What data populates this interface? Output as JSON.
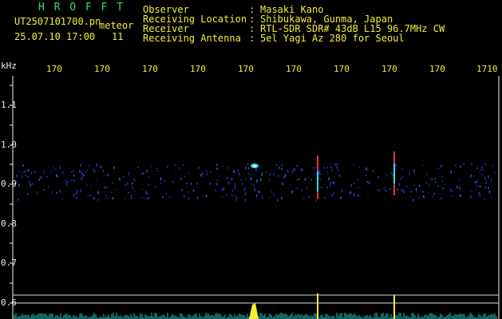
{
  "app": {
    "title_letters": "H R O F F T",
    "filename": "UT2507101700.pn",
    "mode": "meteor",
    "datetime": "25.07.10 17:00",
    "count": "11"
  },
  "info": {
    "rows": [
      {
        "label": "Observer",
        "value": "Masaki Kano"
      },
      {
        "label": "Receiving Location",
        "value": "Shibukawa, Gunma, Japan"
      },
      {
        "label": "Receiver",
        "value": "RTL-SDR SDR# 43dB L15 96.7MHz CW"
      },
      {
        "label": "Receiving Antenna",
        "value": "5el Yagi Az 280 for Seoul"
      }
    ],
    "sep": ":"
  },
  "axes": {
    "y_unit": "kHz",
    "y_ticks": [
      "1.1",
      "1.0",
      "0.9",
      "0.8",
      "0.7",
      "0.6"
    ],
    "x_ticks": [
      "170",
      "170",
      "170",
      "170",
      "170",
      "170",
      "170",
      "170",
      "170",
      "1710"
    ]
  },
  "colors": {
    "background": "#000000",
    "text_yellow": "#f2ee3a",
    "text_white": "#f0f0f0",
    "title_green": "#39d86a",
    "signal_red": "#ff3030",
    "signal_cyan": "#22e0e0",
    "signal_blue": "#3050ff"
  }
}
